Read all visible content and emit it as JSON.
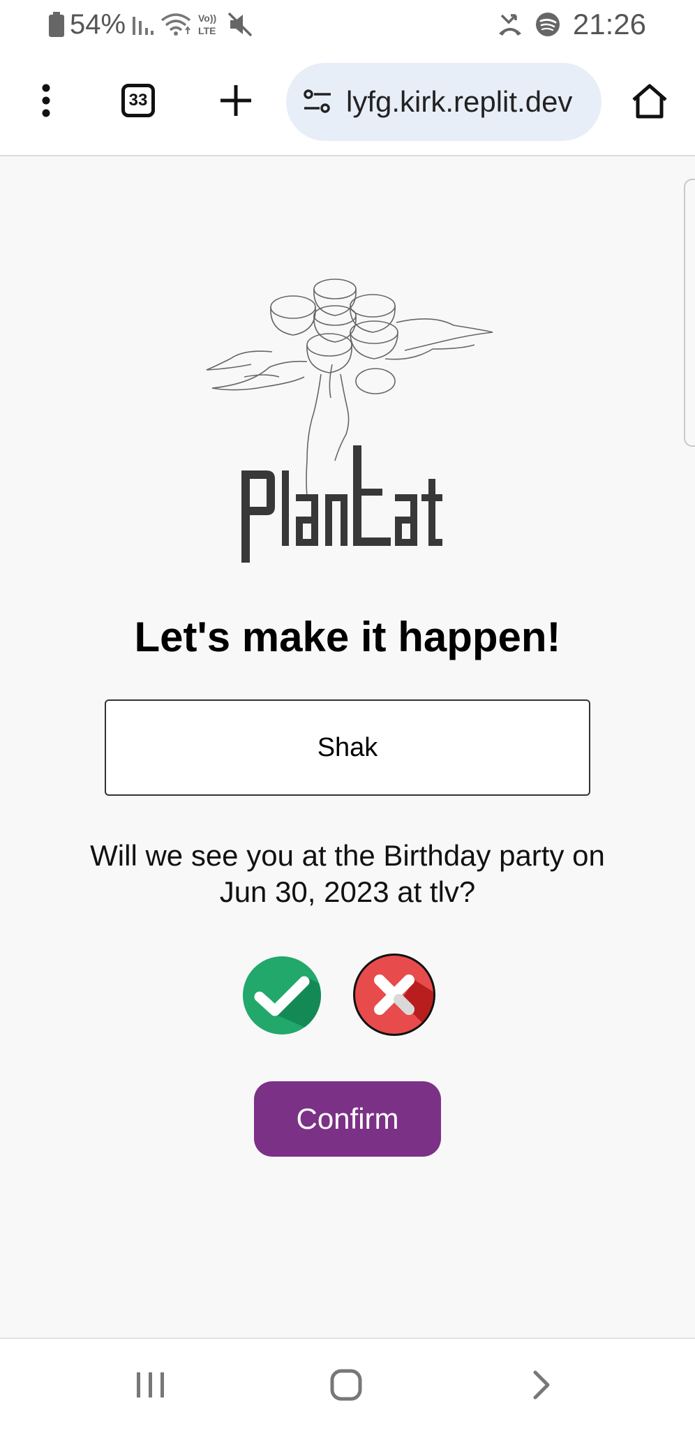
{
  "status_bar": {
    "battery": "54%",
    "time": "21:26",
    "icons": [
      "battery-icon",
      "signal-icon",
      "wifi-icon",
      "volte-icon",
      "mute-icon",
      "missed-call-icon",
      "spotify-icon"
    ],
    "volte_label": "Vo))\nLTE"
  },
  "browser": {
    "tab_count": "33",
    "url": "lyfg.kirk.replit.dev",
    "icons": [
      "more-options-icon",
      "tabs-icon",
      "new-tab-icon",
      "site-settings-icon",
      "home-icon"
    ]
  },
  "logo": {
    "wordmark": "PlanEat"
  },
  "main": {
    "headline": "Let's make it happen!",
    "name_value": "Shak",
    "question": "Will we see you at the Birthday party on Jun 30, 2023 at tlv?",
    "confirm_label": "Confirm"
  },
  "rsvp": {
    "yes_color": "#21a86a",
    "no_color": "#e84b4b",
    "selected": "no"
  },
  "nav": {
    "icons": [
      "recents-icon",
      "home-button-icon",
      "back-icon"
    ]
  },
  "colors": {
    "accent": "#7b3185",
    "url_bar_bg": "#e8eef8",
    "page_bg": "#f8f8f9"
  }
}
